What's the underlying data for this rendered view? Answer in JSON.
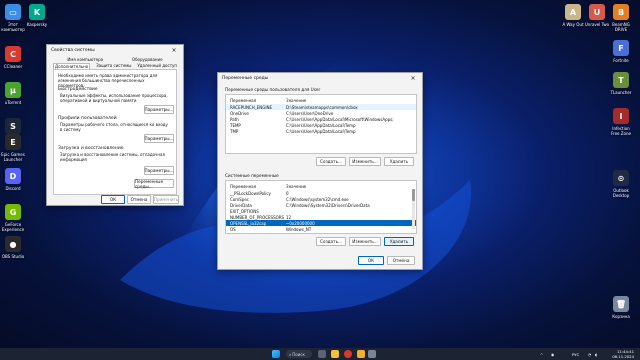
{
  "desktop_left": [
    {
      "name": "this-pc-icon",
      "label": "Этот\nкомпьютер",
      "color": "#3a8ee6",
      "glyph": "▭"
    },
    {
      "name": "ccleaner-icon",
      "label": "CCleaner",
      "color": "#d83b2e",
      "glyph": "C"
    },
    {
      "name": "utorrent-icon",
      "label": "uTorrent",
      "color": "#4aa32e",
      "glyph": "µ"
    },
    {
      "name": "steam-icon",
      "label": "Steam",
      "color": "#1b2838",
      "glyph": "S"
    },
    {
      "name": "epic-games-icon",
      "label": "Epic Games\nLauncher",
      "color": "#2a2a2a",
      "glyph": "E"
    },
    {
      "name": "discord-icon",
      "label": "Discord",
      "color": "#5865f2",
      "glyph": "D"
    },
    {
      "name": "geforce-icon",
      "label": "GeForce\nExperience",
      "color": "#76b900",
      "glyph": "G"
    },
    {
      "name": "obs-icon",
      "label": "OBS Studio",
      "color": "#2b2b2b",
      "glyph": "●"
    }
  ],
  "desktop_kaspersky": {
    "label": "Kaspersky",
    "color": "#00a88e",
    "glyph": "K"
  },
  "desktop_right_top": [
    {
      "name": "a-way-out-icon",
      "label": "A Way Out",
      "color": "#c9b78a",
      "glyph": "A"
    },
    {
      "name": "unravel-two-icon",
      "label": "Unravel Two",
      "color": "#d65a4a",
      "glyph": "U"
    },
    {
      "name": "beamng-icon",
      "label": "BeamNG\nDRIVE",
      "color": "#e67e22",
      "glyph": "B"
    }
  ],
  "desktop_right": [
    {
      "name": "fortnite-icon",
      "label": "Fortnite",
      "color": "#4b6fd6",
      "glyph": "F"
    },
    {
      "name": "tlauncher-icon",
      "label": "TLauncher",
      "color": "#6b8e3a",
      "glyph": "T"
    },
    {
      "name": "infection-free-icon",
      "label": "Infection\nFree Zone",
      "color": "#a62a2a",
      "glyph": "I"
    },
    {
      "name": "deskpro-icon",
      "label": "Outlook\nDesktop",
      "color": "#1f2a44",
      "glyph": "⊙"
    },
    {
      "name": "recycle-bin-icon",
      "label": "Корзина",
      "color": "#7a8899",
      "glyph": "🗑"
    }
  ],
  "sys_props": {
    "title": "Свойства системы",
    "tabs_row1": [
      "Имя компьютера",
      "Оборудование"
    ],
    "tabs_row2": [
      "Дополнительно",
      "Защита системы",
      "Удаленный доступ"
    ],
    "intro": "Необходимо иметь права администратора для изменения большинства перечисленных параметров.",
    "perf_label": "Быстродействие",
    "perf_text": "Визуальные эффекты, использование процессора, оперативной и виртуальной памяти",
    "params_btn": "Параметры...",
    "profiles_label": "Профили пользователей",
    "profiles_text": "Параметры рабочего стола, относящиеся ко входу в систему",
    "recovery_label": "Загрузка и восстановление",
    "recovery_text": "Загрузка и восстановление системы, отладочная информация",
    "env_btn": "Переменные среды...",
    "ok": "ОК",
    "cancel": "Отмена",
    "apply": "Применить"
  },
  "env": {
    "title": "Переменные среды",
    "user_label": "Переменные среды пользователя для User",
    "col_var": "Переменная",
    "col_val": "Значение",
    "user_rows": [
      [
        "RACEPUNCH_ENGINE",
        "D:\\Steam\\steamapps\\common\\cbox"
      ],
      [
        "OneDrive",
        "C:\\Users\\User\\OneDrive"
      ],
      [
        "Path",
        "C:\\Users\\User\\AppData\\Local\\Microsoft\\WindowsApps;"
      ],
      [
        "TEMP",
        "C:\\Users\\User\\AppData\\Local\\Temp"
      ],
      [
        "TMP",
        "C:\\Users\\User\\AppData\\Local\\Temp"
      ]
    ],
    "sys_label": "Системные переменные",
    "sys_rows": [
      [
        "__PSLockDownPolicy",
        "0"
      ],
      [
        "ComSpec",
        "C:\\Windows\\system32\\cmd.exe"
      ],
      [
        "DriverData",
        "C:\\Windows\\System32\\Drivers\\DriverData"
      ],
      [
        "EXIT_OPTIONS",
        ""
      ],
      [
        "NUMBER_OF_PROCESSORS",
        "12"
      ],
      [
        "OPENSSL_ia32cap",
        "~0x20000000"
      ],
      [
        "OS",
        "Windows_NT"
      ]
    ],
    "new_btn": "Создать...",
    "edit_btn": "Изменить...",
    "delete_btn": "Удалить",
    "ok": "ОК",
    "cancel": "Отмена"
  },
  "taskbar": {
    "search": "Поиск",
    "lang": "РУС",
    "time": "11:44:41",
    "date": "08.11.2024"
  }
}
